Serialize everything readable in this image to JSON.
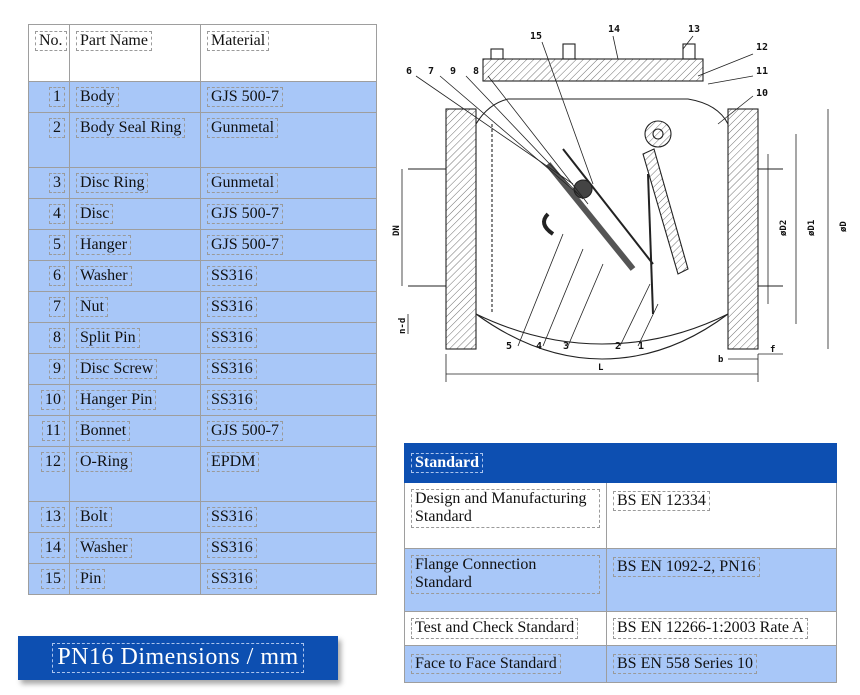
{
  "parts": {
    "headers": [
      "No.",
      "Part Name",
      "Material"
    ],
    "rows": [
      {
        "no": "1",
        "name": "Body",
        "material": "GJS 500-7"
      },
      {
        "no": "2",
        "name": "Body Seal Ring",
        "material": "Gunmetal"
      },
      {
        "no": "3",
        "name": "Disc Ring",
        "material": "Gunmetal"
      },
      {
        "no": "4",
        "name": "Disc",
        "material": "GJS 500-7"
      },
      {
        "no": "5",
        "name": "Hanger",
        "material": "GJS 500-7"
      },
      {
        "no": "6",
        "name": "Washer",
        "material": "SS316"
      },
      {
        "no": "7",
        "name": "Nut",
        "material": "SS316"
      },
      {
        "no": "8",
        "name": "Split Pin",
        "material": "SS316"
      },
      {
        "no": "9",
        "name": "Disc Screw",
        "material": "SS316"
      },
      {
        "no": "10",
        "name": "Hanger Pin",
        "material": "SS316"
      },
      {
        "no": "11",
        "name": "Bonnet",
        "material": "GJS 500-7"
      },
      {
        "no": "12",
        "name": "O-Ring",
        "material": "EPDM"
      },
      {
        "no": "13",
        "name": "Bolt",
        "material": "SS316"
      },
      {
        "no": "14",
        "name": "Washer",
        "material": "SS316"
      },
      {
        "no": "15",
        "name": "Pin",
        "material": "SS316"
      }
    ]
  },
  "drawing": {
    "callouts": [
      "1",
      "2",
      "3",
      "4",
      "5",
      "6",
      "7",
      "8",
      "9",
      "10",
      "11",
      "12",
      "13",
      "14",
      "15"
    ],
    "dims": {
      "dn": "DN",
      "nd": "n-d",
      "d2": "øD2",
      "d1": "øD1",
      "d": "øD",
      "l": "L",
      "b": "b",
      "f": "f"
    }
  },
  "standards": {
    "title": "Standard",
    "rows": [
      {
        "label": "Design and Manufacturing Standard",
        "value": "BS EN 12334"
      },
      {
        "label": "Flange Connection Standard",
        "value": "BS EN 1092-2, PN16"
      },
      {
        "label": "Test and Check Standard",
        "value": "BS EN 12266-1:2003 Rate A"
      },
      {
        "label": "Face to Face Standard",
        "value": "BS EN 558 Series 10"
      }
    ]
  },
  "banner": {
    "text": "PN16 Dimensions / mm"
  },
  "colors": {
    "row_blue": "#a8c7f8",
    "header_blue": "#0d4fb1"
  }
}
